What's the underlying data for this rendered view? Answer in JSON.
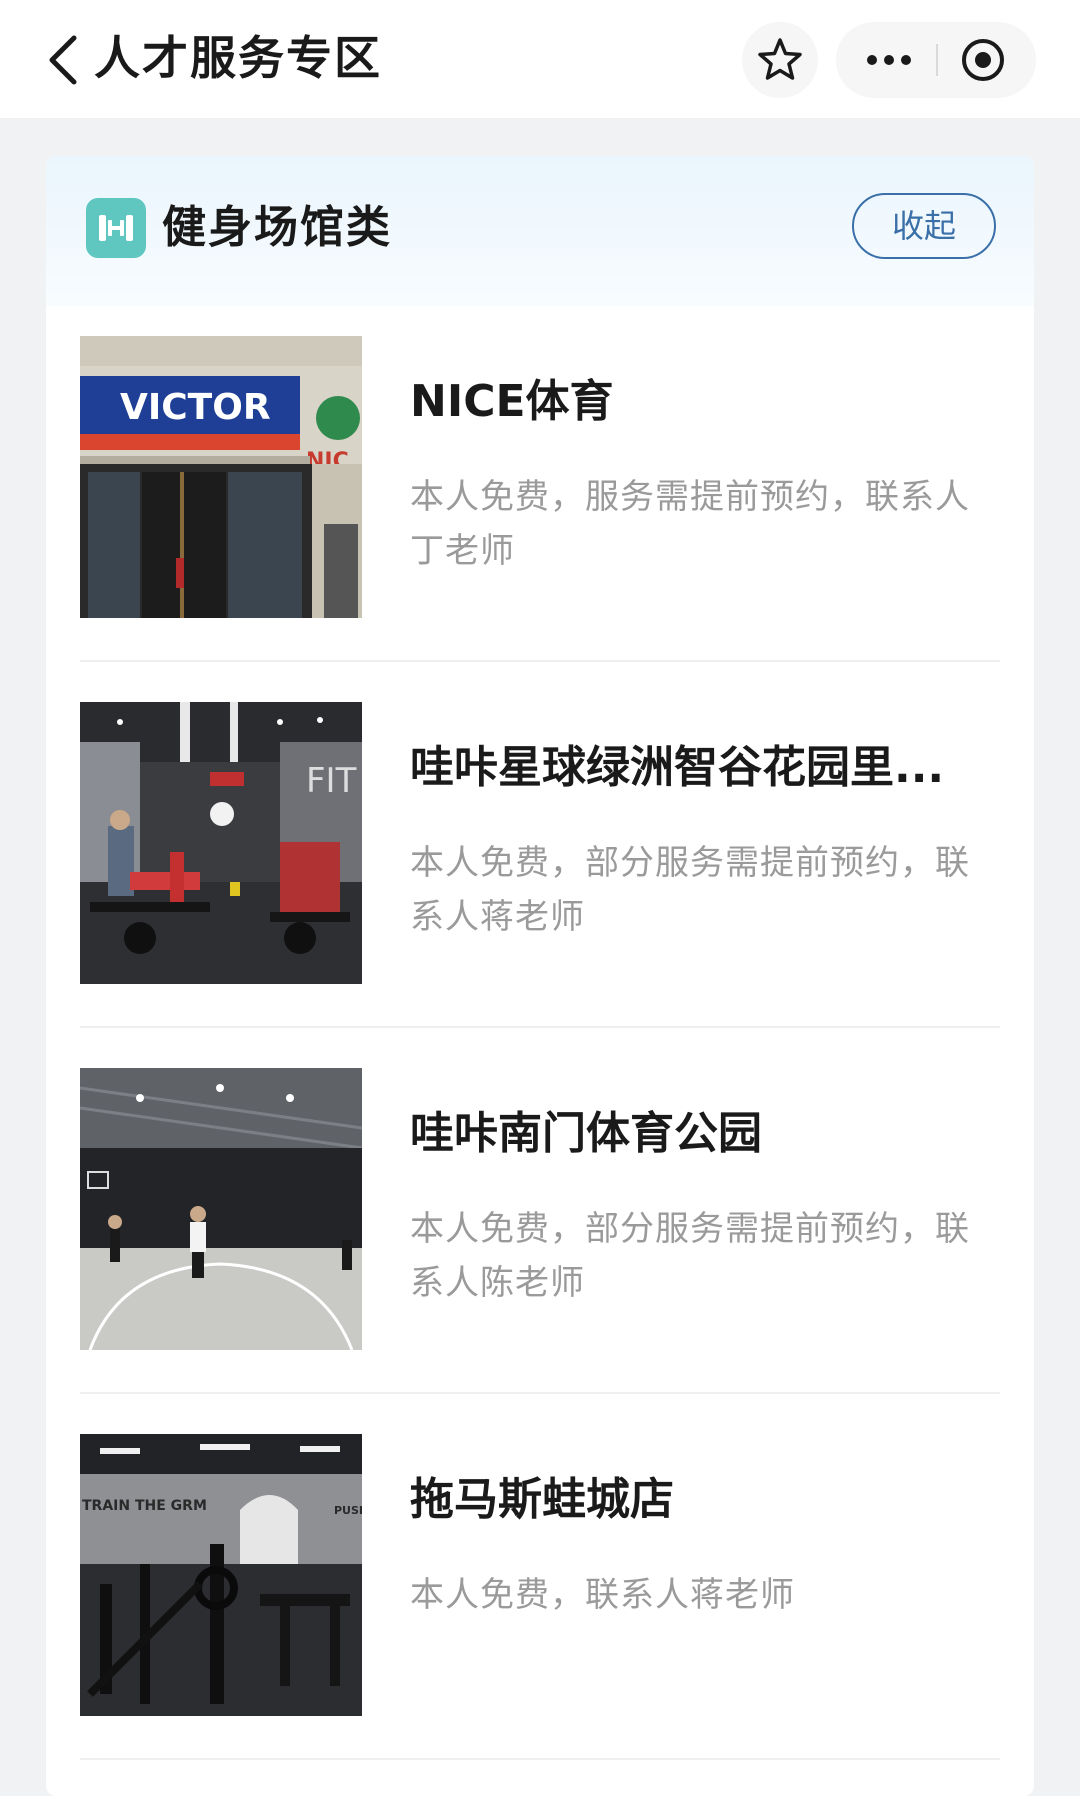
{
  "nav": {
    "title": "人才服务专区",
    "back_icon": "chevron-left-icon",
    "favorite_icon": "star-outline-icon",
    "more_icon": "more-dots-icon",
    "close_icon": "target-close-icon"
  },
  "category": {
    "icon": "dumbbell-icon",
    "title": "健身场馆类",
    "collapse_label": "收起",
    "accent_color": "#3a6fa8",
    "icon_color": "#5fc7c0"
  },
  "items": [
    {
      "title": "NICE体育",
      "desc": "本人免费，服务需提前预约，联系人丁老师",
      "image_text": "VICTOR",
      "image_side_text": "NIC"
    },
    {
      "title": "哇咔星球绿洲智谷花园里...",
      "desc": "本人免费，部分服务需提前预约，联系人蒋老师",
      "image_side_text": "FIT"
    },
    {
      "title": "哇咔南门体育公园",
      "desc": "本人免费，部分服务需提前预约，联系人陈老师"
    },
    {
      "title": "拖马斯蛙城店",
      "desc": "本人免费，联系人蒋老师",
      "image_text": "TRAIN THE GRM",
      "image_side_text": "PUSH"
    }
  ]
}
